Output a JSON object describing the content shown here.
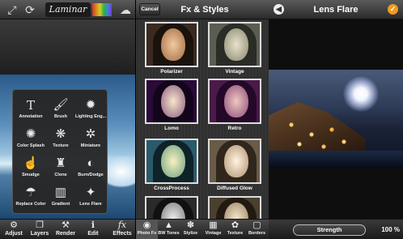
{
  "left": {
    "toolbar": {
      "logo_text": "Laminar"
    },
    "menu": {
      "items": [
        {
          "label": "Annotation",
          "icon": "text-T-icon"
        },
        {
          "label": "Brush",
          "icon": "brush-icon"
        },
        {
          "label": "Lighting Eng...",
          "icon": "sun-icon"
        },
        {
          "label": "Color Splash",
          "icon": "splash-icon"
        },
        {
          "label": "Texture",
          "icon": "texture-icon"
        },
        {
          "label": "Miniature",
          "icon": "miniature-icon"
        },
        {
          "label": "Smudge",
          "icon": "finger-icon"
        },
        {
          "label": "Clone",
          "icon": "stamp-icon"
        },
        {
          "label": "Burn/Dodge",
          "icon": "burn-dodge-icon"
        },
        {
          "label": "Replace Color",
          "icon": "droplets-icon"
        },
        {
          "label": "Gradient",
          "icon": "gradient-icon"
        },
        {
          "label": "Lens Flare",
          "icon": "sparkle-icon"
        }
      ]
    },
    "bottom_tabs": [
      {
        "label": "Adjust",
        "icon": "adjust-icon"
      },
      {
        "label": "Layers",
        "icon": "layers-icon"
      },
      {
        "label": "Render",
        "icon": "render-icon"
      },
      {
        "label": "Edit",
        "icon": "edit-icon"
      },
      {
        "label": "Effects",
        "icon": "fx-icon"
      }
    ]
  },
  "middle": {
    "cancel_label": "Cancel",
    "title": "Fx & Styles",
    "thumbnails": [
      {
        "label": "Polarizer"
      },
      {
        "label": "Vintage"
      },
      {
        "label": "Lomo"
      },
      {
        "label": "Retro"
      },
      {
        "label": "CrossProcess"
      },
      {
        "label": "Diffused Glow"
      },
      {
        "label": ""
      },
      {
        "label": ""
      }
    ],
    "bottom_tabs": [
      {
        "label": "Photo Fx",
        "icon": "camera-icon"
      },
      {
        "label": "BW Tones",
        "icon": "mountain-icon"
      },
      {
        "label": "Stylize",
        "icon": "stylize-icon"
      },
      {
        "label": "Vintage",
        "icon": "vintage-icon"
      },
      {
        "label": "Texture",
        "icon": "texture-icon"
      },
      {
        "label": "Borders",
        "icon": "border-icon"
      }
    ]
  },
  "right": {
    "title": "Lens Flare",
    "strength_label": "Strength",
    "strength_value": "100 %"
  },
  "colors": {
    "accent": "#f39a1e",
    "panel": "#2a2a2a"
  }
}
